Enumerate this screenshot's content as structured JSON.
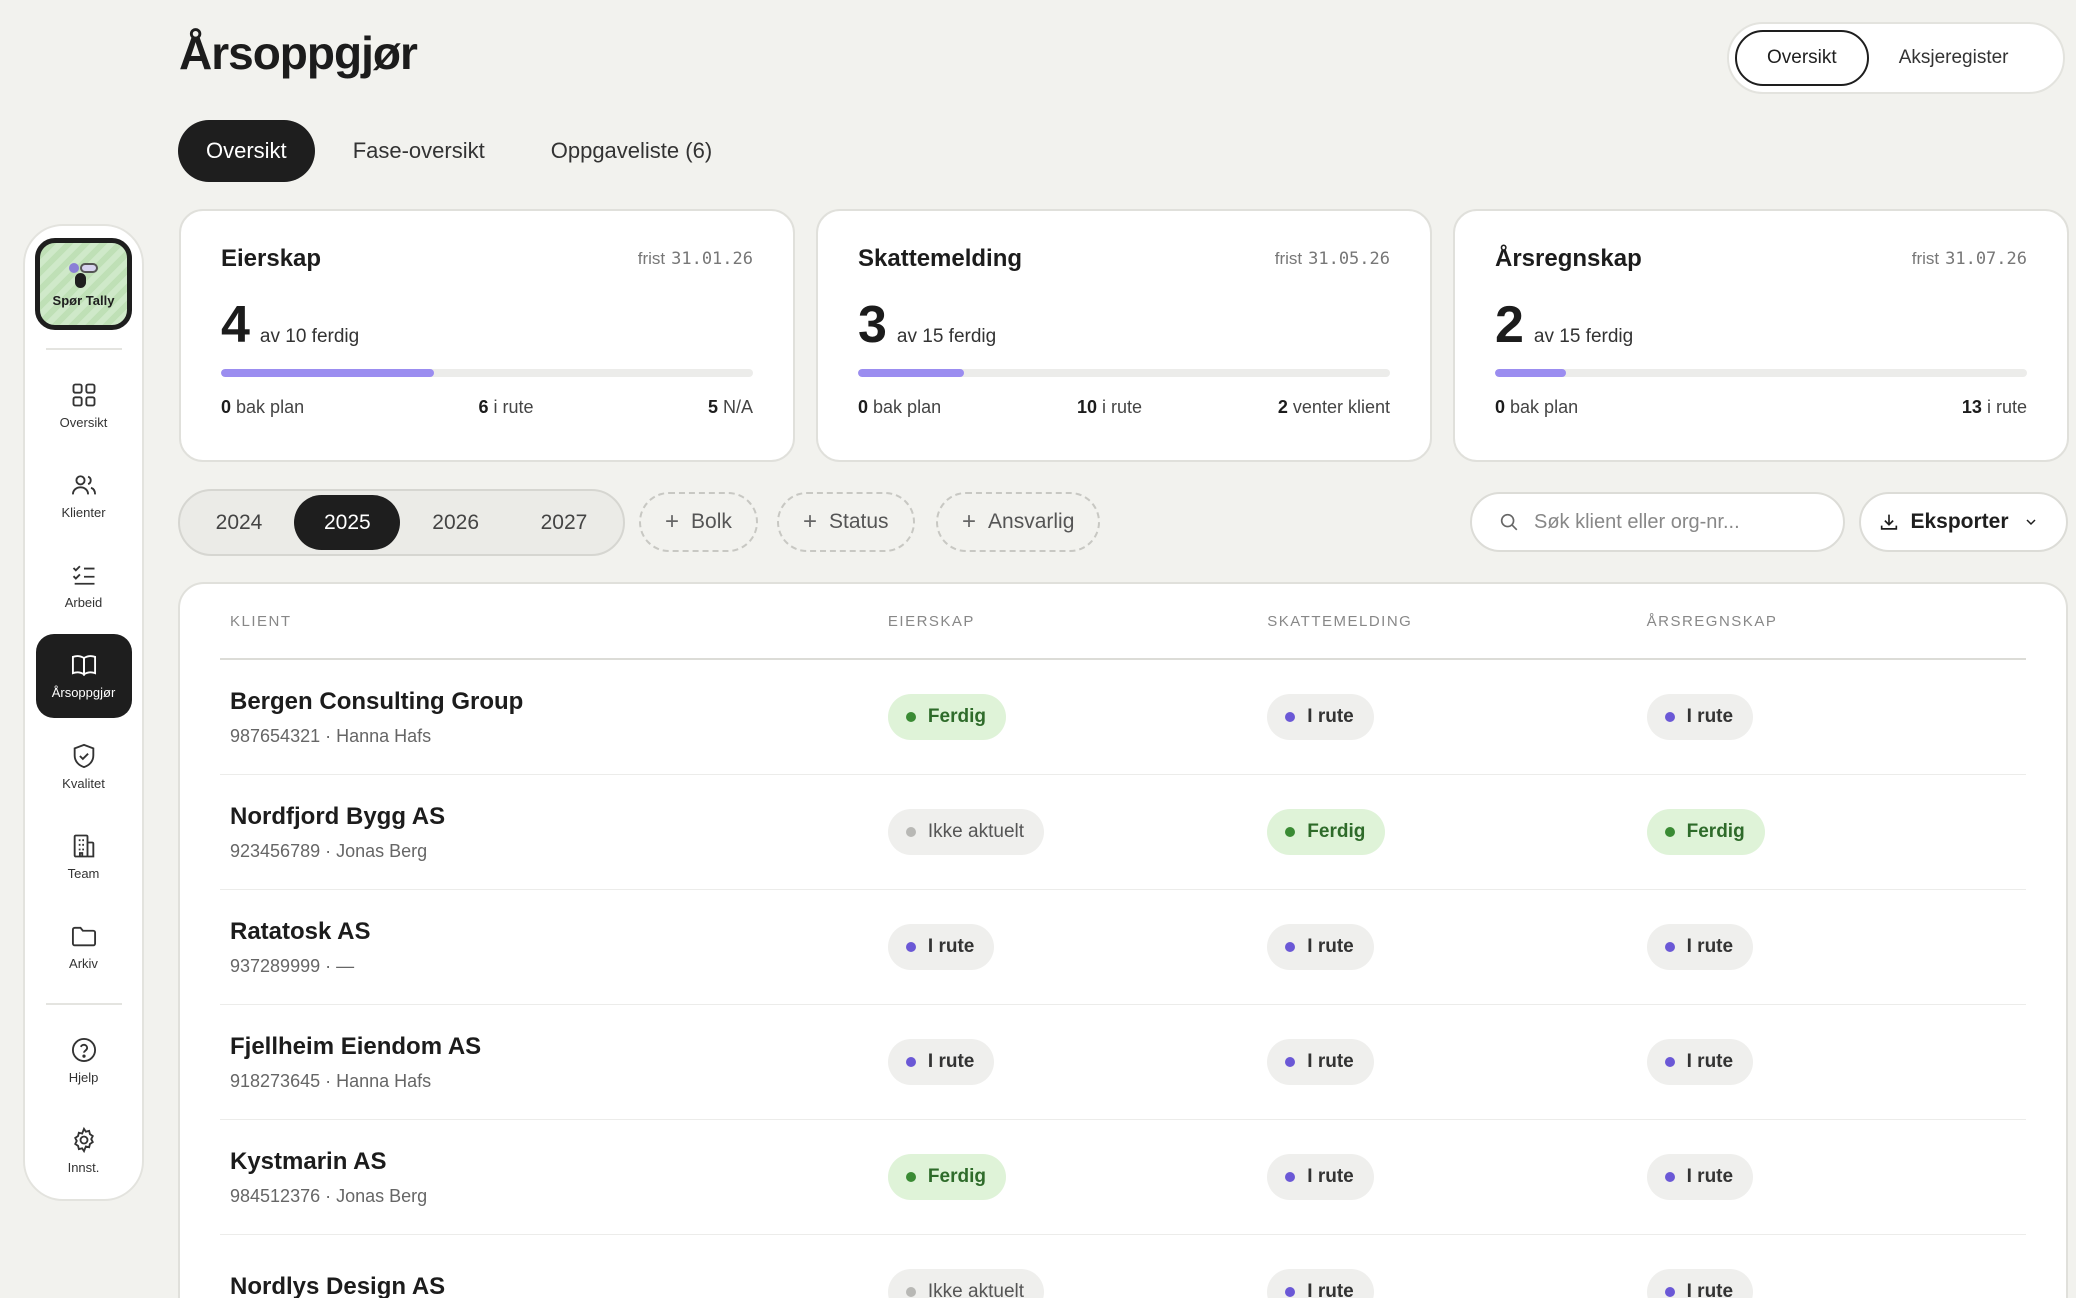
{
  "sidebar": {
    "tally_label": "Spør Tally",
    "items": [
      {
        "label": "Oversikt",
        "icon": "grid-icon"
      },
      {
        "label": "Klienter",
        "icon": "users-icon"
      },
      {
        "label": "Arbeid",
        "icon": "checklist-icon"
      },
      {
        "label": "Årsoppgjør",
        "icon": "book-icon",
        "active": true
      },
      {
        "label": "Kvalitet",
        "icon": "shield-check-icon"
      },
      {
        "label": "Team",
        "icon": "building-icon"
      },
      {
        "label": "Arkiv",
        "icon": "folder-icon"
      }
    ],
    "bottom_items": [
      {
        "label": "Hjelp",
        "icon": "help-icon"
      },
      {
        "label": "Innst.",
        "icon": "gear-icon"
      }
    ]
  },
  "header": {
    "title": "Årsoppgjør",
    "view_toggle": [
      "Oversikt",
      "Aksjeregister"
    ],
    "active_view": "Oversikt"
  },
  "tabs": [
    "Oversikt",
    "Fase-oversikt",
    "Oppgaveliste (6)"
  ],
  "cards": [
    {
      "title": "Eierskap",
      "deadline_label": "frist",
      "deadline": "31.01.26",
      "done": "4",
      "of_text": "av 10 ferdig",
      "progress": 0.4,
      "stats": [
        {
          "n": "0",
          "t": "bak plan"
        },
        {
          "n": "6",
          "t": "i rute"
        },
        {
          "n": "5",
          "t": "N/A"
        }
      ]
    },
    {
      "title": "Skattemelding",
      "deadline_label": "frist",
      "deadline": "31.05.26",
      "done": "3",
      "of_text": "av 15 ferdig",
      "progress": 0.2,
      "stats": [
        {
          "n": "0",
          "t": "bak plan"
        },
        {
          "n": "10",
          "t": "i rute"
        },
        {
          "n": "2",
          "t": "venter klient"
        }
      ]
    },
    {
      "title": "Årsregnskap",
      "deadline_label": "frist",
      "deadline": "31.07.26",
      "done": "2",
      "of_text": "av 15 ferdig",
      "progress": 0.133,
      "stats": [
        {
          "n": "0",
          "t": "bak plan"
        },
        {
          "n": "13",
          "t": "i rute"
        }
      ]
    }
  ],
  "filters": {
    "years": [
      "2024",
      "2025",
      "2026",
      "2027"
    ],
    "active_year": "2025",
    "chips": [
      "Bolk",
      "Status",
      "Ansvarlig"
    ],
    "search_placeholder": "Søk klient eller org-nr...",
    "export_label": "Eksporter"
  },
  "table": {
    "columns": [
      "KLIENT",
      "EIERSKAP",
      "SKATTEMELDING",
      "ÅRSREGNSKAP"
    ],
    "rows": [
      {
        "name": "Bergen Consulting Group",
        "meta": "987654321 · Hanna Hafs",
        "e": "Ferdig",
        "s": "I rute",
        "a": "I rute"
      },
      {
        "name": "Nordfjord Bygg AS",
        "meta": "923456789 · Jonas Berg",
        "e": "Ikke aktuelt",
        "s": "Ferdig",
        "a": "Ferdig"
      },
      {
        "name": "Ratatosk AS",
        "meta": "937289999 · —",
        "e": "I rute",
        "s": "I rute",
        "a": "I rute"
      },
      {
        "name": "Fjellheim Eiendom AS",
        "meta": "918273645 · Hanna Hafs",
        "e": "I rute",
        "s": "I rute",
        "a": "I rute"
      },
      {
        "name": "Kystmarin AS",
        "meta": "984512376 · Jonas Berg",
        "e": "Ferdig",
        "s": "I rute",
        "a": "I rute"
      },
      {
        "name": "Nordlys Design AS",
        "meta": "",
        "e": "Ikke aktuelt",
        "s": "I rute",
        "a": "I rute"
      }
    ]
  },
  "colors": {
    "accent": "#9b8df0",
    "dark": "#1e1e1e",
    "done_bg": "#dff3d8",
    "done_dot": "#3a8b34",
    "on_track_dot": "#6b58d6"
  }
}
